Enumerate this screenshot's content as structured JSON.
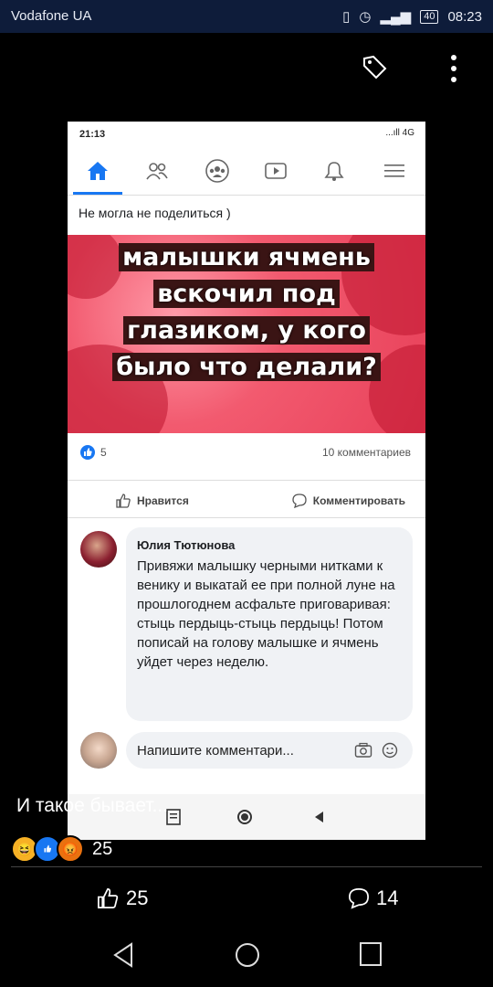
{
  "outer_status": {
    "carrier": "Vodafone UA",
    "battery": "40",
    "time": "08:23"
  },
  "inner_status": {
    "time": "21:13",
    "network": "...ıll 4G"
  },
  "post": {
    "text": "Не могла не поделиться )",
    "meme_lines": [
      "малышки ячмень",
      "вскочил под",
      "глазиком, у кого",
      "было что делали?"
    ],
    "reactions_count": "5",
    "comments_count": "10 комментариев",
    "like_label": "Нравится",
    "comment_label": "Комментировать"
  },
  "comment": {
    "author": "Юлия Тютюнова",
    "text": "Привяжи малышку черными нитками к венику и выкатай ее при полной луне на прошлогоднем асфальте приговаривая: стыць пердыць-стыць пердыць! Потом пописай на голову малышке и ячмень уйдет через неделю."
  },
  "comment_input": {
    "placeholder": "Напишите комментари..."
  },
  "outer_post": {
    "caption": "И такое бывает...",
    "reactions_count": "25",
    "likes": "25",
    "comments": "14"
  },
  "colors": {
    "accent": "#1877f2",
    "meme_bg": "#e8415a",
    "status_bar": "#0e1c3a"
  }
}
